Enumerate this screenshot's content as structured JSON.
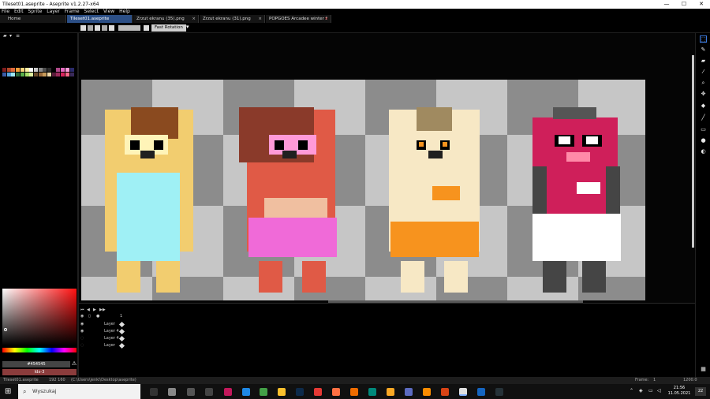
{
  "window": {
    "title": "Tileset01.aseprite - Aseprite v1.2.27-x64",
    "minimize": "—",
    "maximize": "☐",
    "close": "✕"
  },
  "menu": [
    "File",
    "Edit",
    "Sprite",
    "Layer",
    "Frame",
    "Select",
    "View",
    "Help"
  ],
  "tabs": [
    {
      "label": "Home",
      "active": false
    },
    {
      "label": "Tileset01.aseprite",
      "active": true
    },
    {
      "label": "Zrzut ekranu (35).png",
      "active": false
    },
    {
      "label": "Zrzut ekranu (31).png",
      "active": false
    },
    {
      "label": "POPGOES Arcadee winter f",
      "active": false
    }
  ],
  "toolbar": {
    "rotation_label": "Fast Rotation",
    "dropdown_icon": "chevron-down-icon"
  },
  "palette": {
    "colors": [
      "#7f1d1d",
      "#b34a2a",
      "#e06b3b",
      "#f59e3a",
      "#f7d37a",
      "#fff3a8",
      "#ffffff",
      "#c8c8c8",
      "#8a8a8a",
      "#4d4d4d",
      "#2b2b2b",
      "#000000",
      "#b04a8a",
      "#e66ac0",
      "#ff9ad8",
      "#2a2a6a",
      "#3a5ca8",
      "#5aa7e0",
      "#9fe8f5",
      "#2a6a3a",
      "#5ab04a",
      "#a8e06a",
      "#e0f0a0",
      "#6a4a2a",
      "#9a6a3a",
      "#c79a5a",
      "#f0d8a8",
      "#5a1a3a",
      "#9a2a5a",
      "#d8245c",
      "#ff6a8a",
      "#3a2a5a"
    ]
  },
  "color": {
    "hex": "#454545",
    "index": "Idx-3",
    "accent": "#3c7be0",
    "warn_icon": "warning-icon"
  },
  "tools": [
    "marquee-icon",
    "pencil-icon",
    "eraser-icon",
    "eyedropper-icon",
    "zoom-icon",
    "move-icon",
    "bucket-icon",
    "line-icon",
    "rectangle-icon",
    "blur-icon",
    "contour-icon"
  ],
  "timeline": {
    "frame_number": "1",
    "layers": [
      {
        "name": "Layer",
        "visible": true
      },
      {
        "name": "Layer 4",
        "visible": true
      },
      {
        "name": "Layer 4",
        "visible": false
      },
      {
        "name": "Layer",
        "visible": false
      }
    ]
  },
  "status": {
    "file": "Tileset01.aseprite",
    "size": "192 160",
    "path": "(C:\\Users\\jenki\\Desktop\\aseprite)",
    "frame_label": "Frame:",
    "frame_value": "1",
    "zoom": "1200.0"
  },
  "taskbar": {
    "search_placeholder": "Wyszukaj",
    "time": "21:56",
    "date": "11.05.2021",
    "notification_count": "22"
  }
}
